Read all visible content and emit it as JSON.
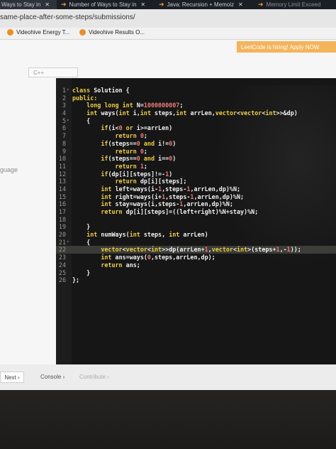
{
  "browser": {
    "tabs": [
      {
        "label": "Ways to Stay in"
      },
      {
        "label": "Number of Ways to Stay in"
      },
      {
        "label": "Java: Recursion + Memoiz"
      },
      {
        "label": "Memory Limit Exceed"
      }
    ],
    "url": "same-place-after-some-steps/submissions/",
    "bookmarks": [
      "Videohive Energy T...",
      "Videohive Results O..."
    ]
  },
  "page": {
    "banner": "LeetCode is hiring! Apply NOW.",
    "language_select": "C++",
    "side_label": "guage",
    "next_button": "Next",
    "console_label": "Console",
    "contribute_label": "Contribute"
  },
  "editor": {
    "highlight_line": 22,
    "lines": [
      {
        "n": "1",
        "fold": true,
        "code": "class Solution {"
      },
      {
        "n": "2",
        "fold": false,
        "code": "public:"
      },
      {
        "n": "3",
        "fold": false,
        "code": "    long long int N=1000000007;"
      },
      {
        "n": "4",
        "fold": false,
        "code": "    int ways(int i,int steps,int arrLen,vector<vector<int>>&dp)"
      },
      {
        "n": "5",
        "fold": true,
        "code": "    {"
      },
      {
        "n": "6",
        "fold": false,
        "code": "        if(i<0 or i>=arrLen)"
      },
      {
        "n": "7",
        "fold": false,
        "code": "            return 0;"
      },
      {
        "n": "8",
        "fold": false,
        "code": "        if(steps==0 and i!=0)"
      },
      {
        "n": "9",
        "fold": false,
        "code": "            return 0;"
      },
      {
        "n": "10",
        "fold": false,
        "code": "        if(steps==0 and i==0)"
      },
      {
        "n": "11",
        "fold": false,
        "code": "            return 1;"
      },
      {
        "n": "12",
        "fold": false,
        "code": "        if(dp[i][steps]!=-1)"
      },
      {
        "n": "13",
        "fold": false,
        "code": "            return dp[i][steps];"
      },
      {
        "n": "14",
        "fold": false,
        "code": "        int left=ways(i-1,steps-1,arrLen,dp)%N;"
      },
      {
        "n": "15",
        "fold": false,
        "code": "        int right=ways(i+1,steps-1,arrLen,dp)%N;"
      },
      {
        "n": "16",
        "fold": false,
        "code": "        int stay=ways(i,steps-1,arrLen,dp)%N;"
      },
      {
        "n": "17",
        "fold": false,
        "code": "        return dp[i][steps]=((left+right)%N+stay)%N;"
      },
      {
        "n": "18",
        "fold": false,
        "code": ""
      },
      {
        "n": "19",
        "fold": false,
        "code": "    }"
      },
      {
        "n": "20",
        "fold": false,
        "code": "    int numWays(int steps, int arrLen)"
      },
      {
        "n": "21",
        "fold": true,
        "code": "    {"
      },
      {
        "n": "22",
        "fold": false,
        "code": "        vector<vector<int>>dp(arrLen+1,vector<int>(steps+1,-1));"
      },
      {
        "n": "23",
        "fold": false,
        "code": "        int ans=ways(0,steps,arrLen,dp);"
      },
      {
        "n": "24",
        "fold": false,
        "code": "        return ans;"
      },
      {
        "n": "25",
        "fold": false,
        "code": "    }"
      },
      {
        "n": "26",
        "fold": false,
        "code": "};"
      }
    ]
  }
}
